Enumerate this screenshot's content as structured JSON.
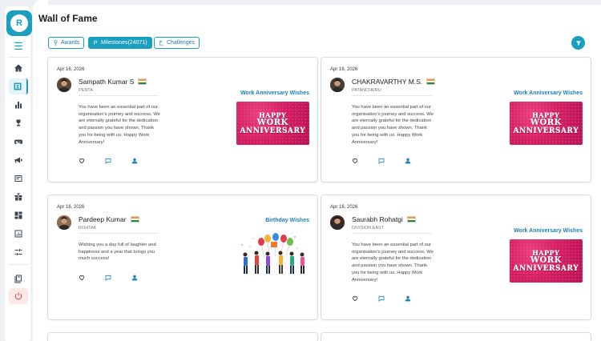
{
  "sidebar": {
    "avatar_letter": "R",
    "icons": [
      "menu-icon",
      "home-icon",
      "wall-of-fame-icon",
      "analytics-icon",
      "trophy-icon",
      "gamepad-icon",
      "megaphone-icon",
      "catalog-icon",
      "gift-icon",
      "dashboard-icon",
      "reports-icon",
      "settings-sliders-icon",
      "library-icon",
      "power-icon"
    ]
  },
  "page": {
    "title": "Wall of Fame"
  },
  "tabs": [
    {
      "label": "Awards",
      "icon": "award-icon",
      "active": false
    },
    {
      "label": "Milestones(24071)",
      "icon": "flag-icon",
      "active": true
    },
    {
      "label": "Challenges",
      "icon": "challenge-icon",
      "active": false
    }
  ],
  "colors": {
    "accent": "#1a9fc0",
    "link": "#1b7fb5",
    "banner": "#d41e62"
  },
  "cards": [
    {
      "date": "Apr 16, 2026",
      "name": "Sampath Kumar S",
      "location": "PENTA",
      "type": "Work Anniversary Wishes",
      "message": "You have been an essential part of our organisation's journey and success. We are eternally grateful for the dedication and passion you have shown. Thank you for being with us. Happy Work Anniversary!",
      "banner": {
        "l1": "HAPPY",
        "l2": "WORK",
        "l3": "ANNIVERSARY"
      }
    },
    {
      "date": "Apr 16, 2026",
      "name": "CHAKRAVARTHY M.S.",
      "location": "PATANCHERU",
      "type": "Work Anniversary Wishes",
      "message": "You have been an essential part of our organisation's journey and success. We are eternally grateful for the dedication and passion you have shown. Thank you for being with us. Happy Work Anniversary!",
      "banner": {
        "l1": "HAPPY",
        "l2": "WORK",
        "l3": "ANNIVERSARY"
      }
    },
    {
      "date": "Apr 16, 2026",
      "name": "Pardeep Kumar",
      "location": "ROHTAK",
      "type": "Birthday Wishes",
      "message": "Wishing you a day full of laughter and happiness and a year that brings you much success!"
    },
    {
      "date": "Apr 16, 2026",
      "name": "Saurabh Rohatgi",
      "location": "DIVISION EAST",
      "type": "Work Anniversary Wishes",
      "message": "You have been an essential part of our organisation's journey and success. We are eternally grateful for the dedication and passion you have shown. Thank you for being with us. Happy Work Anniversary!",
      "banner": {
        "l1": "HAPPY",
        "l2": "WORK",
        "l3": "ANNIVERSARY"
      }
    }
  ]
}
